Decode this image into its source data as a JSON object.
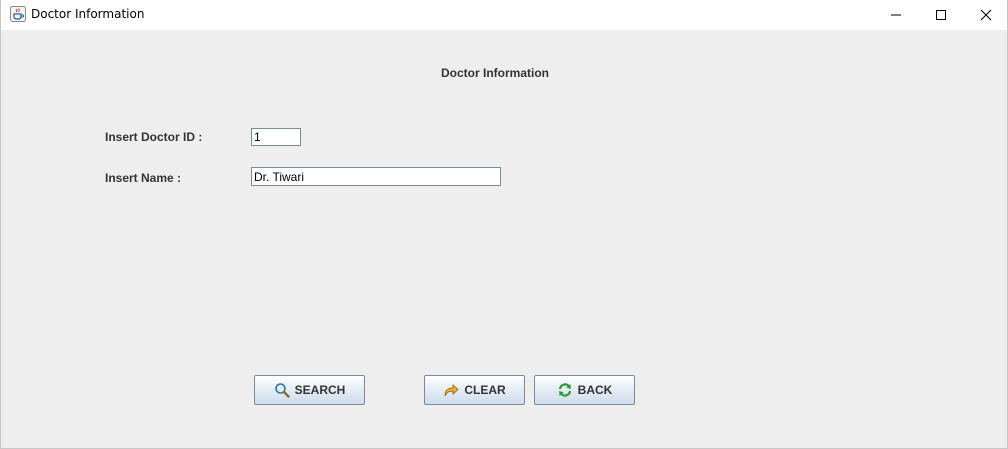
{
  "window": {
    "title": "Doctor Information"
  },
  "form": {
    "heading": "Doctor Information",
    "doctor_id_label": "Insert Doctor ID :",
    "doctor_id_value": "1",
    "name_label": "Insert Name :",
    "name_value": "Dr. Tiwari"
  },
  "buttons": {
    "search": "SEARCH",
    "clear": "CLEAR",
    "back": "BACK"
  },
  "icons": {
    "app": "java-cup-icon",
    "minimize": "minimize-icon",
    "maximize": "maximize-icon",
    "close": "close-icon",
    "search": "magnifier-icon",
    "clear": "redo-arrow-icon",
    "back": "refresh-icon"
  },
  "colors": {
    "background": "#eeeeee",
    "text": "#333333",
    "button_gradient_top": "#ffffff",
    "button_gradient_bottom": "#cfdcea"
  }
}
